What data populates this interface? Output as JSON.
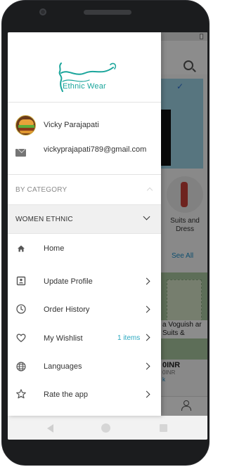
{
  "app": {
    "logo_text": "Ethnic Wear",
    "accent_color": "#1aa59b"
  },
  "profile": {
    "name": "Vicky Parajapati",
    "email": "vickyprajapati789@gmail.com",
    "avatar_icon": "burger-avatar",
    "email_icon": "mail-icon"
  },
  "categories": {
    "header_label": "BY CATEGORY",
    "header_icon": "chevron-up-icon",
    "selected": "WOMEN ETHNIC",
    "selected_icon": "chevron-down-icon"
  },
  "menu": {
    "items": [
      {
        "label": "Home",
        "icon": "home-icon",
        "has_chevron": false
      },
      {
        "label": "Update Profile",
        "icon": "profile-card-icon",
        "has_chevron": true
      },
      {
        "label": "Order History",
        "icon": "clock-icon",
        "has_chevron": true
      },
      {
        "label": "My Wishlist",
        "icon": "heart-icon",
        "badge": "1 items",
        "has_chevron": true
      },
      {
        "label": "Languages",
        "icon": "globe-icon",
        "has_chevron": true
      },
      {
        "label": "Rate the app",
        "icon": "star-icon",
        "has_chevron": true
      }
    ]
  },
  "background_app": {
    "category_label": "Suits and Dress",
    "see_all": "See All",
    "product_title": "a Voguish ar Suits &",
    "price": "0INR",
    "price_sub": "0INR",
    "price_link": "k"
  }
}
